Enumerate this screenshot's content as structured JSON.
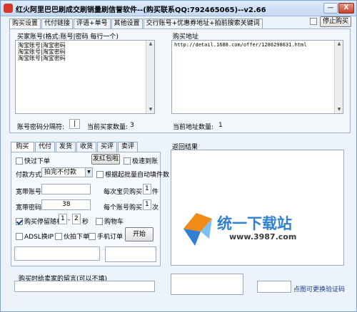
{
  "window": {
    "title": "红火阿里巴巴刷成交刷销量刷信誉软件--(购买联系QQ:792465065)--v2.66",
    "minimize": "—",
    "close": "X",
    "stop_label": "停止购买"
  },
  "main_tabs": [
    "购买设置",
    "代付链接",
    "评语+单号",
    "其他设置",
    "交行账号+优惠券地址+拍前搜索关键词"
  ],
  "buyer": {
    "label": "买家账号(格式:账号|密码 每行一个)",
    "accounts": "淘宝账号|淘宝密码\n淘宝账号|淘宝密码\n淘宝账号|淘宝密码",
    "separator_label": "账号密码分隔符:",
    "separator_value": "|",
    "count_label": "当前买家数量:",
    "count_value": "3"
  },
  "address": {
    "label": "购买地址",
    "value": "http://detail.1688.com/offer/1286298631.html",
    "count_label": "当前地址数量:",
    "count_value": "1"
  },
  "sub_tabs": [
    "购买",
    "代付",
    "发货",
    "收货",
    "买评",
    "卖评"
  ],
  "buy": {
    "fast_order": "快过下单",
    "red_packet_button": "发红包啦",
    "fast_reach": "极速到账",
    "pay_method_label": "付款方式:",
    "pay_method_value": "拍完不付款",
    "auto_fill": "根据起批量自动填件数",
    "bb_account_label": "宽带账号",
    "bb_account_value": "",
    "per_item_label": "每次宝贝购买",
    "per_item_value": "1",
    "per_item_unit": "件",
    "bb_password_label": "宽带密码",
    "bb_password_value": "38",
    "per_account_label": "每个账号购买",
    "per_account_value": "1",
    "per_account_unit": "次",
    "stay_random_label": "购买停留随机",
    "stay_from": "1",
    "stay_sep": "-",
    "stay_to": "2",
    "stay_unit": "秒",
    "cart": "购物车",
    "adsl": "ADSL换IP",
    "fake_order": "伙拍下单",
    "mobile_order": "手机订单",
    "start_button": "开始"
  },
  "result": {
    "label": "返回结果",
    "text": ""
  },
  "message": {
    "label": "购买时给卖家的留言(可以不填)",
    "value": ""
  },
  "captcha": {
    "link": "点图可更换验证码"
  },
  "watermark": {
    "brand": "统一下载站",
    "url": "www.3987.com"
  },
  "colors": {
    "titlebar": "#c4d9f3",
    "accent": "#2f7fd2",
    "close": "#c5422c"
  }
}
